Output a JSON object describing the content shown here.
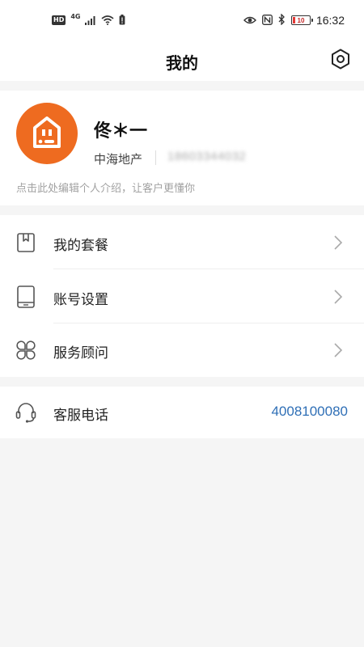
{
  "status_bar": {
    "hd": "HD",
    "network": "4G",
    "battery_level": "10",
    "time": "16:32"
  },
  "header": {
    "title": "我的",
    "settings_icon": "hexagon-gear-icon"
  },
  "profile": {
    "name": "佟＊一",
    "company": "中海地产",
    "phone": "18603344032",
    "intro_hint": "点击此处编辑个人介绍，让客户更懂你",
    "avatar_icon": "house-logo-icon",
    "avatar_color": "#EE6B20"
  },
  "menu": [
    {
      "label": "我的套餐",
      "icon": "bookmark-book-icon"
    },
    {
      "label": "账号设置",
      "icon": "tablet-icon"
    },
    {
      "label": "服务顾问",
      "icon": "clover-icon"
    }
  ],
  "service": {
    "label": "客服电话",
    "phone": "4008100080",
    "icon": "headset-icon",
    "accent": "#2F6FB6"
  }
}
